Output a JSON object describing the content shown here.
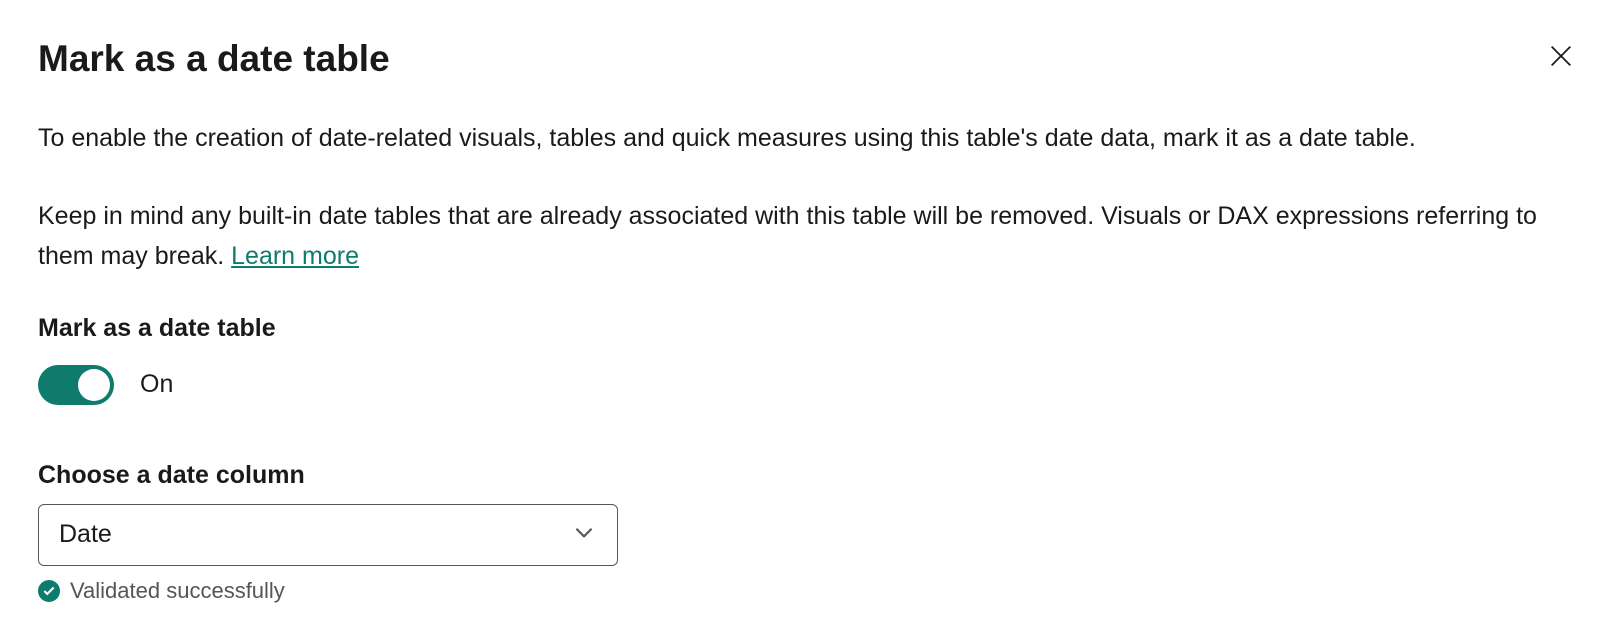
{
  "dialog": {
    "title": "Mark as a date table",
    "description1": "To enable the creation of date-related visuals, tables and quick measures using this table's date data, mark it as a date table.",
    "description2_prefix": "Keep in mind any built-in date tables that are already associated with this table will be removed. Visuals or DAX expressions referring to them may break. ",
    "learn_more_label": "Learn more"
  },
  "toggle": {
    "section_label": "Mark as a date table",
    "state_label": "On",
    "on": true
  },
  "column": {
    "section_label": "Choose a date column",
    "selected_value": "Date"
  },
  "validation": {
    "message": "Validated successfully"
  },
  "colors": {
    "accent": "#0f7b6c"
  }
}
